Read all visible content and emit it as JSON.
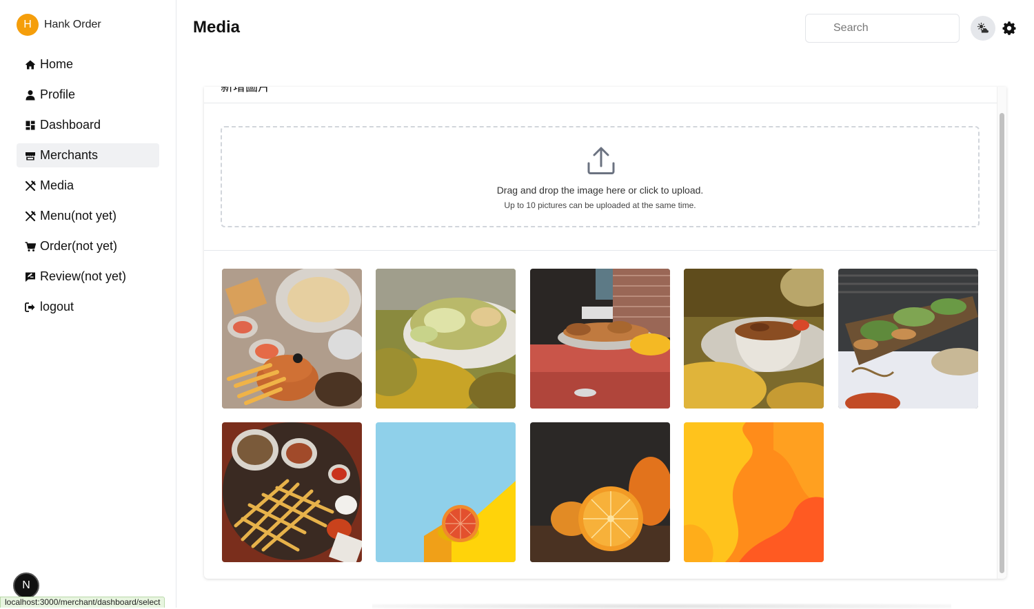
{
  "app": {
    "name": "Hank Order",
    "avatar_letter": "H",
    "avatar_color": "#f59e0b"
  },
  "sidebar": {
    "items": [
      {
        "label": "Home",
        "icon": "home-icon"
      },
      {
        "label": "Profile",
        "icon": "user-icon"
      },
      {
        "label": "Dashboard",
        "icon": "dashboard-icon"
      },
      {
        "label": "Merchants",
        "icon": "store-icon",
        "active": true
      },
      {
        "label": "Media",
        "icon": "utensils-icon"
      },
      {
        "label": "Menu(not yet)",
        "icon": "utensils-icon"
      },
      {
        "label": "Order(not yet)",
        "icon": "cart-icon"
      },
      {
        "label": "Review(not yet)",
        "icon": "review-icon"
      },
      {
        "label": "logout",
        "icon": "logout-icon"
      }
    ]
  },
  "header": {
    "title": "Media",
    "search_placeholder": "Search"
  },
  "panel": {
    "header_text": "新增圖片",
    "dropzone": {
      "main_text": "Drag and drop the image here or click to upload.",
      "sub_text": "Up to 10 pictures can be uploaded at the same time."
    },
    "images": [
      {
        "name": "burger-pasta-table"
      },
      {
        "name": "salad-plate"
      },
      {
        "name": "buffet-pastries"
      },
      {
        "name": "bowl-stew"
      },
      {
        "name": "catering-table"
      },
      {
        "name": "fries-platter"
      },
      {
        "name": "grapefruit-blue-yellow"
      },
      {
        "name": "orange-dark"
      },
      {
        "name": "orange-abstract"
      }
    ]
  },
  "next_badge": "N",
  "status_url": "localhost:3000/merchant/dashboard/select"
}
